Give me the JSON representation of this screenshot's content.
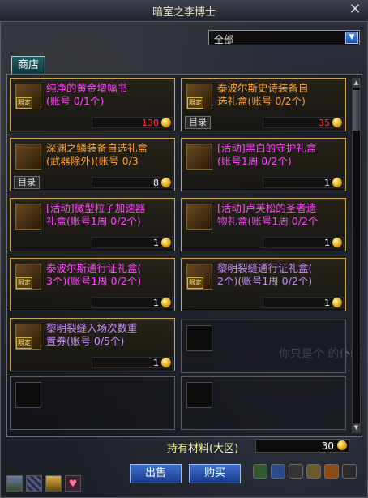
{
  "window": {
    "title": "暗室之李博士",
    "close_icon": "close-icon"
  },
  "filter": {
    "selected": "全部"
  },
  "tabs": [
    {
      "label": "商店"
    }
  ],
  "items": [
    {
      "name": "纯净的黄金增幅书\n(账号 0/1个)",
      "color": "magenta",
      "price": "130",
      "price_color": "red",
      "limited": true,
      "catalog": false,
      "icon": "golden-scroll-icon"
    },
    {
      "name": "泰波尔斯史诗装备自\n选礼盒(账号 0/2个)",
      "color": "orange",
      "price": "35",
      "price_color": "red",
      "limited": true,
      "catalog": true,
      "icon": "epic-box-icon"
    },
    {
      "name": "深渊之鳞装备自选礼盒\n(武器除外)(账号 0/3",
      "color": "orange",
      "price": "8",
      "price_color": "white",
      "limited": false,
      "catalog": true,
      "icon": "abyss-box-icon"
    },
    {
      "name": "[活动]黑白的守护礼盒\n(账号1周 0/2个)",
      "color": "magenta",
      "price": "1",
      "price_color": "white",
      "limited": false,
      "catalog": false,
      "icon": "guardian-box-icon"
    },
    {
      "name": "[活动]微型粒子加速器\n礼盒(账号1周 0/2个)",
      "color": "magenta",
      "price": "1",
      "price_color": "white",
      "limited": false,
      "catalog": false,
      "icon": "accelerator-box-icon"
    },
    {
      "name": "[活动]卢芙松的圣者遗\n物礼盒(账号1周 0/2个",
      "color": "magenta",
      "price": "1",
      "price_color": "white",
      "limited": false,
      "catalog": false,
      "icon": "relic-box-icon"
    },
    {
      "name": "泰波尔斯通行证礼盒(\n3个)(账号1周 0/2个)",
      "color": "magenta",
      "price": "1",
      "price_color": "white",
      "limited": true,
      "catalog": false,
      "icon": "pass-box-icon"
    },
    {
      "name": "黎明裂缝通行证礼盒(\n2个)(账号1周 0/2个)",
      "color": "lavender",
      "price": "1",
      "price_color": "white",
      "limited": true,
      "catalog": false,
      "icon": "dawn-pass-box-icon"
    },
    {
      "name": "黎明裂缝入场次数重\n置券(账号 0/5个)",
      "color": "lavender",
      "price": "1",
      "price_color": "white",
      "limited": true,
      "catalog": false,
      "icon": "reset-ticket-icon"
    }
  ],
  "labels": {
    "limited": "限定",
    "catalog": "目录"
  },
  "materials": {
    "label": "持有材料(大区)",
    "value": "30"
  },
  "buttons": {
    "sell": "出售",
    "buy": "购买"
  },
  "watermark": "你只是个 的仆装"
}
